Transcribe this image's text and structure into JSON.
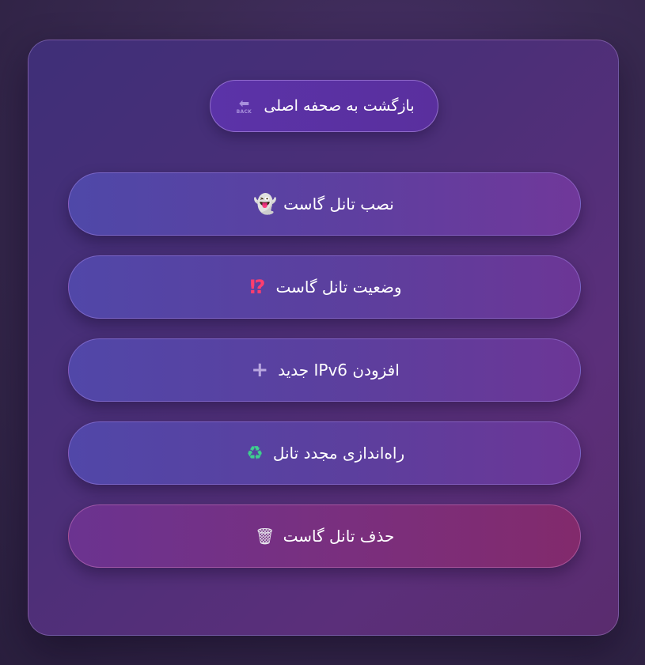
{
  "back_button": {
    "label": "بازگشت به صحفه اصلی",
    "icon": "back-arrow-icon",
    "icon_text": "BACK"
  },
  "menu": {
    "items": [
      {
        "label": "نصب تانل گاست",
        "icon": "ghost-icon",
        "glyph": "👻"
      },
      {
        "label": "وضعیت تانل گاست",
        "icon": "interrobang-icon",
        "glyph": "⁉"
      },
      {
        "label": "افزودن IPv6 جدید",
        "icon": "plus-icon",
        "glyph": "+"
      },
      {
        "label": "راه‌اندازی مجدد تانل",
        "icon": "recycle-icon",
        "glyph": "♻"
      },
      {
        "label": "حذف تانل گاست",
        "icon": "trash-icon",
        "glyph": "🗑"
      }
    ]
  },
  "colors": {
    "panel_accent": "#5b33a8",
    "danger": "#822a6c",
    "recycle": "#3ecf8e",
    "interrobang": "#ff3d6e"
  }
}
